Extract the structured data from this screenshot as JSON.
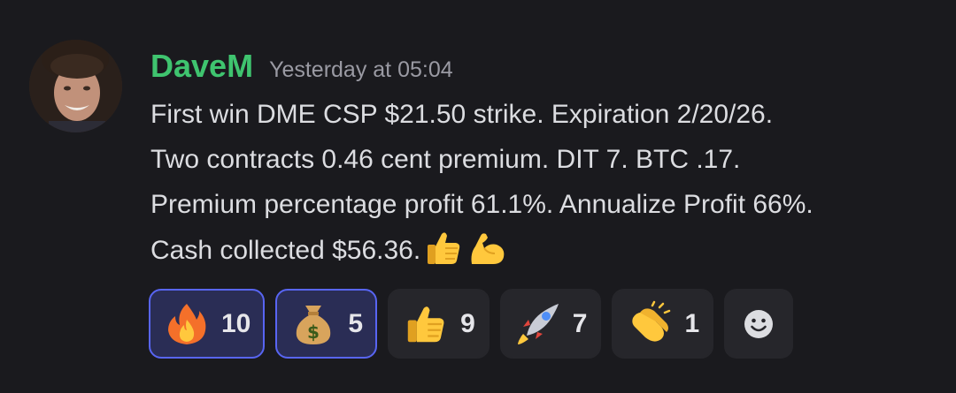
{
  "message": {
    "username": "DaveM",
    "timestamp": "Yesterday at 05:04",
    "lines": [
      "First win DME CSP $21.50 strike. Expiration 2/20/26.",
      "Two contracts 0.46 cent premium. DIT 7. BTC .17.",
      "Premium percentage profit 61.1%. Annualize Profit 66%.",
      "Cash collected $56.36."
    ],
    "trailing_emojis": [
      "thumbs-up",
      "flexed-biceps"
    ]
  },
  "reactions": [
    {
      "emoji": "fire",
      "count": "10",
      "active": true
    },
    {
      "emoji": "money-bag",
      "count": "5",
      "active": true
    },
    {
      "emoji": "thumbs-up",
      "count": "9",
      "active": false
    },
    {
      "emoji": "rocket",
      "count": "7",
      "active": false
    },
    {
      "emoji": "clapping-hands",
      "count": "1",
      "active": false
    }
  ],
  "add_reaction": {
    "icon": "smiley-add-reaction"
  },
  "colors": {
    "background": "#1a1a1e",
    "username": "#3fc46f",
    "timestamp": "#9a9aa3",
    "text": "#dcdde1",
    "reaction_bg": "#26262b",
    "reaction_active_bg": "#2a2d55",
    "reaction_active_border": "#5865f2"
  }
}
